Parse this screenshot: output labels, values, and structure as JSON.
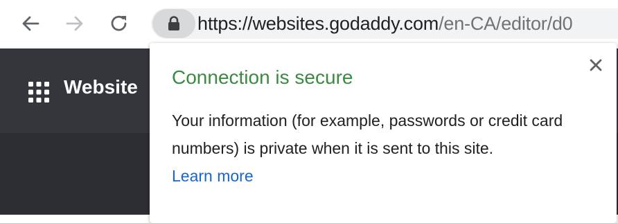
{
  "browser": {
    "url_host": "https://websites.godaddy.com",
    "url_path": "/en-CA/editor/d0",
    "icons": {
      "back": "arrow-left-icon",
      "forward": "arrow-right-icon",
      "reload": "reload-icon",
      "security": "lock-icon"
    }
  },
  "page": {
    "brand": "Website"
  },
  "popup": {
    "title": "Connection is secure",
    "body": "Your information (for example, passwords or credit card numbers) is private when it is sent to this site.",
    "link": "Learn more",
    "colors": {
      "title": "#3a8b3f",
      "link": "#1a66c7"
    }
  }
}
